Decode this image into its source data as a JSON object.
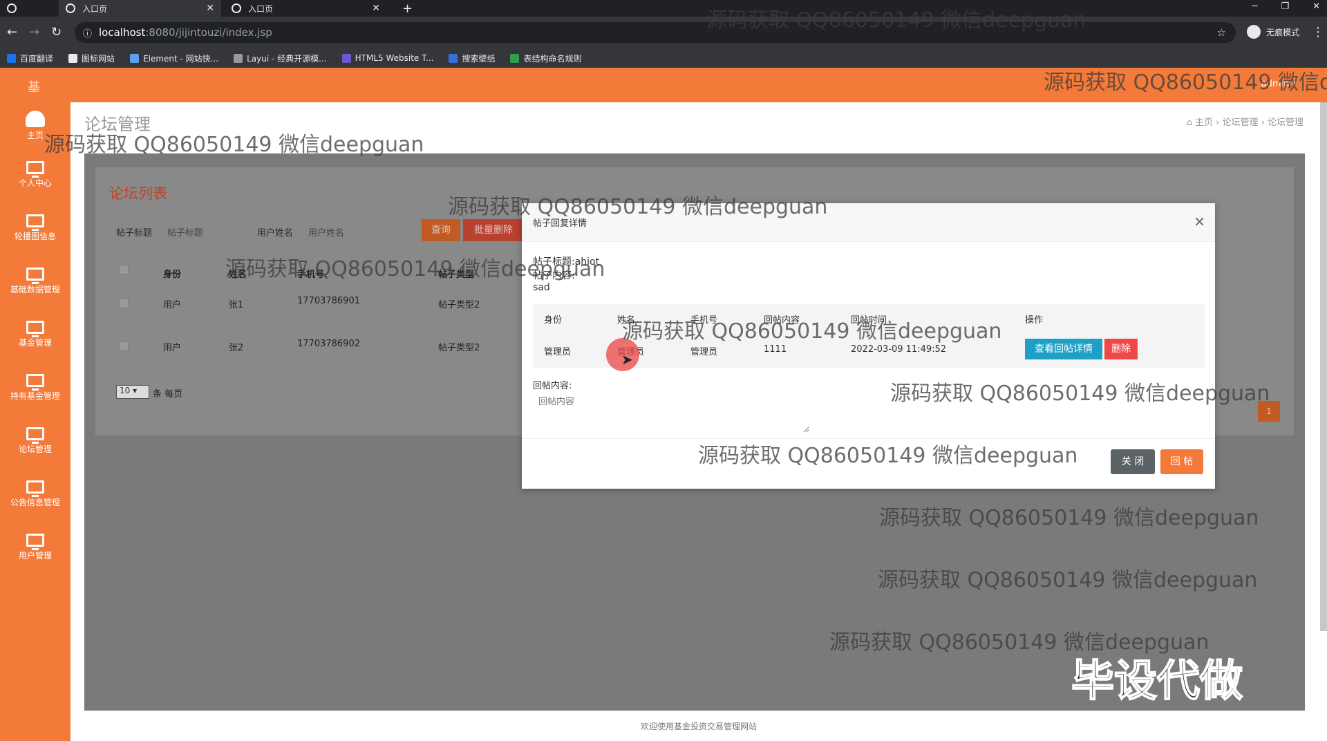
{
  "browser": {
    "tabs": [
      {
        "label": "入口页"
      },
      {
        "label": "入口页"
      }
    ],
    "url_host": "localhost",
    "url_path": ":8080/jijintouzi/index.jsp",
    "profile_label": "无痕模式",
    "bookmarks": [
      "百度翻译",
      "图标网站",
      "Element - 网站快...",
      "Layui - 经典开源模...",
      "HTML5 Website T...",
      "搜索壁纸",
      "表结构命名规则"
    ]
  },
  "header": {
    "brand": "基",
    "user": "admin ▾"
  },
  "sidebar": {
    "items": [
      {
        "label": "主页",
        "icon": "dashboard-icon"
      },
      {
        "label": "个人中心",
        "icon": "monitor-icon"
      },
      {
        "label": "轮播图信息",
        "icon": "monitor-icon"
      },
      {
        "label": "基础数据管理",
        "icon": "monitor-icon"
      },
      {
        "label": "基金管理",
        "icon": "monitor-icon"
      },
      {
        "label": "持有基金管理",
        "icon": "monitor-icon"
      },
      {
        "label": "论坛管理",
        "icon": "monitor-icon"
      },
      {
        "label": "公告信息管理",
        "icon": "monitor-icon"
      },
      {
        "label": "用户管理",
        "icon": "monitor-icon"
      }
    ]
  },
  "page": {
    "title": "论坛管理",
    "breadcrumb": [
      "主页",
      "论坛管理",
      "论坛管理"
    ]
  },
  "list": {
    "title": "论坛列表",
    "filters": [
      {
        "label": "帖子标题",
        "placeholder": "帖子标题"
      },
      {
        "label": "用户姓名",
        "placeholder": "用户姓名"
      }
    ],
    "search_button": "查询",
    "batch_delete_button": "批量删除",
    "columns": [
      "身份",
      "姓名",
      "手机号",
      "帖子类型"
    ],
    "rows": [
      {
        "role": "用户",
        "name": "张1",
        "phone": "17703786901",
        "type": "帖子类型2"
      },
      {
        "role": "用户",
        "name": "张2",
        "phone": "17703786902",
        "type": "帖子类型2"
      }
    ],
    "page_size": "10",
    "page_size_label": "条 每页",
    "current_page": "1"
  },
  "modal": {
    "title": "帖子回复详情",
    "post_title_line": "帖子标题:ahiot",
    "post_content_label": "帖子内容:",
    "post_content": "sad",
    "reply_columns": [
      "身份",
      "姓名",
      "手机号",
      "回帖内容",
      "回帖时间",
      "操作"
    ],
    "reply_row": {
      "role": "管理员",
      "name": "管理员",
      "phone": "管理员",
      "content": "1111",
      "time": "2022-03-09 11:49:52"
    },
    "view_button": "查看回帖详情",
    "delete_button": "删除",
    "reply_label": "回帖内容:",
    "reply_placeholder": "回帖内容",
    "close_button": "关 闭",
    "reply_button": "回 帖"
  },
  "footer": {
    "text": "欢迎使用基金投资交易管理网站"
  },
  "watermark": {
    "text": "源码获取 QQ86050149 微信deepguan",
    "text_cut": "源码获取 QQ86050149 微信d",
    "big": "毕设代做"
  }
}
